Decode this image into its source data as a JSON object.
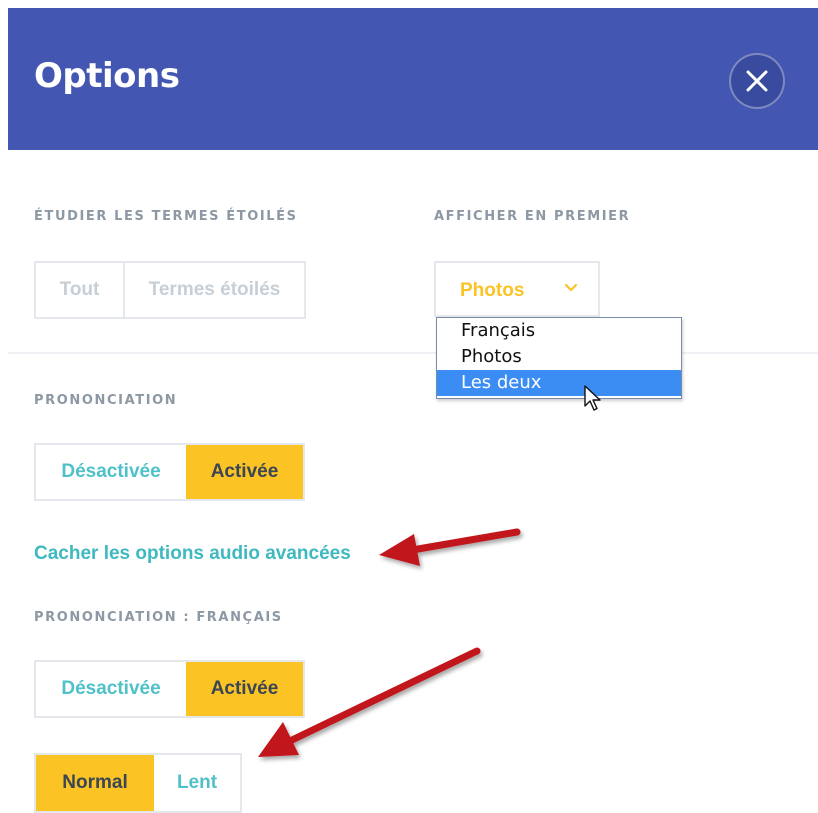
{
  "header": {
    "title": "Options"
  },
  "colors": {
    "header_bg": "#4356b1",
    "accent_yellow": "#fbc324",
    "accent_teal": "#4fc1c9",
    "arrow_red": "#c0161a",
    "dropdown_highlight": "#3b8df4"
  },
  "starred": {
    "label": "ÉTUDIER LES TERMES ÉTOILÉS",
    "options": [
      "Tout",
      "Termes étoilés"
    ]
  },
  "display_first": {
    "label": "AFFICHER EN PREMIER",
    "selected": "Photos",
    "options": [
      "Français",
      "Photos",
      "Les deux"
    ],
    "highlighted": "Les deux"
  },
  "pronunciation": {
    "label": "PRONONCIATION",
    "options": [
      "Désactivée",
      "Activée"
    ],
    "selected": "Activée"
  },
  "audio_link": "Cacher les options audio avancées",
  "pronunciation_fr": {
    "label": "PRONONCIATION : FRANÇAIS",
    "options": [
      "Désactivée",
      "Activée"
    ],
    "selected": "Activée"
  },
  "speed": {
    "options": [
      "Normal",
      "Lent"
    ],
    "selected": "Normal"
  },
  "icons": [
    "close-icon",
    "chevron-down-icon",
    "mouse-cursor-icon",
    "annotation-arrow-icon"
  ]
}
